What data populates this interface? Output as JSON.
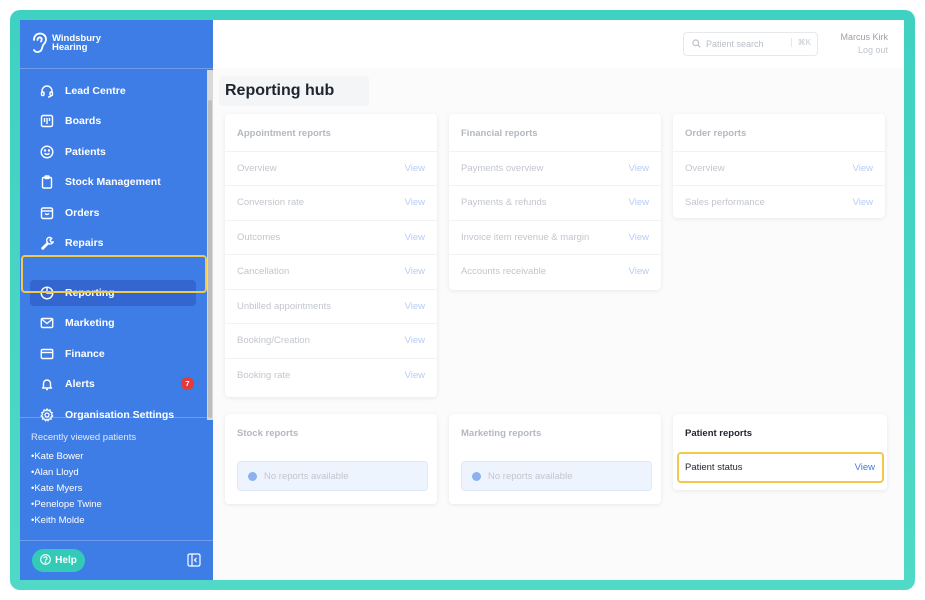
{
  "brand": {
    "name_line1": "Windsbury",
    "name_line2": "Hearing"
  },
  "nav": {
    "items": [
      {
        "label": "Lead Centre",
        "icon": "headset-icon"
      },
      {
        "label": "Boards",
        "icon": "board-icon"
      },
      {
        "label": "Patients",
        "icon": "smile-icon"
      },
      {
        "label": "Stock Management",
        "icon": "clipboard-icon"
      },
      {
        "label": "Orders",
        "icon": "inbox-icon"
      },
      {
        "label": "Repairs",
        "icon": "wrench-icon"
      },
      {
        "label": "Reporting",
        "icon": "pie-chart-icon",
        "active": true
      },
      {
        "label": "Marketing",
        "icon": "mail-icon"
      },
      {
        "label": "Finance",
        "icon": "card-icon"
      },
      {
        "label": "Alerts",
        "icon": "bell-icon",
        "badge": "7"
      },
      {
        "label": "Organisation Settings",
        "icon": "gear-icon"
      }
    ]
  },
  "recent": {
    "title": "Recently viewed patients",
    "patients": [
      "Kate Bower",
      "Alan Lloyd",
      "Kate Myers",
      "Penelope Twine",
      "Keith Molde"
    ]
  },
  "help": {
    "label": "Help"
  },
  "topbar": {
    "search_placeholder": "Patient search",
    "search_shortcut": "⌘K",
    "user_name": "Marcus Kirk",
    "logout": "Log out"
  },
  "page": {
    "title": "Reporting hub"
  },
  "cards": {
    "appointment": {
      "title": "Appointment reports",
      "rows": [
        "Overview",
        "Conversion rate",
        "Outcomes",
        "Cancellation",
        "Unbilled appointments",
        "Booking/Creation",
        "Booking rate"
      ]
    },
    "financial": {
      "title": "Financial reports",
      "rows": [
        "Payments overview",
        "Payments & refunds",
        "Invoice item revenue & margin",
        "Accounts receivable"
      ]
    },
    "order": {
      "title": "Order reports",
      "rows": [
        "Overview",
        "Sales performance"
      ]
    },
    "stock": {
      "title": "Stock reports",
      "empty": "No reports available"
    },
    "marketing": {
      "title": "Marketing reports",
      "empty": "No reports available"
    },
    "patient": {
      "title": "Patient reports",
      "rows": [
        "Patient status"
      ]
    }
  },
  "view_label": "View",
  "colors": {
    "sidebar": "#3f7de6",
    "accent_teal": "#3fd1c1",
    "highlight": "#f2c94c",
    "badge": "#e23b3b"
  }
}
